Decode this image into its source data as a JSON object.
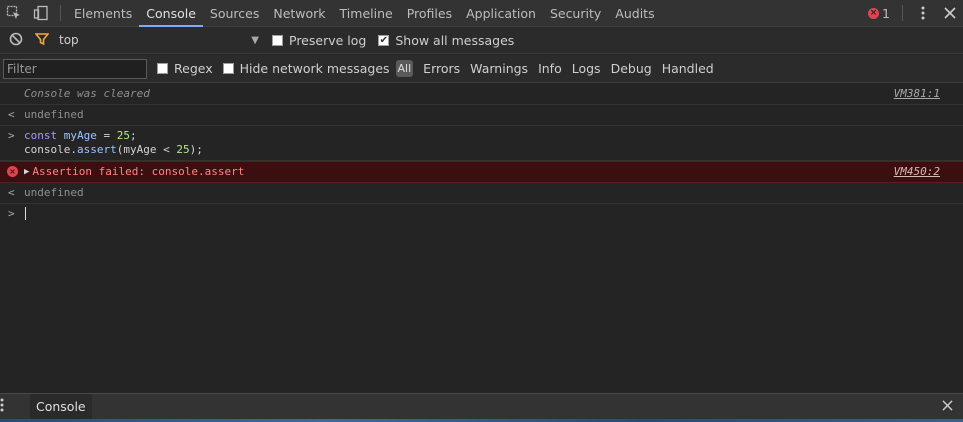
{
  "tabs": [
    "Elements",
    "Console",
    "Sources",
    "Network",
    "Timeline",
    "Profiles",
    "Application",
    "Security",
    "Audits"
  ],
  "active_tab": "Console",
  "error_count": "1",
  "toolbar": {
    "context": "top",
    "preserve_log_label": "Preserve log",
    "preserve_log_checked": false,
    "show_all_label": "Show all messages",
    "show_all_checked": true
  },
  "filter": {
    "placeholder": "Filter",
    "regex_label": "Regex",
    "hide_network_label": "Hide network messages",
    "levels": [
      "All",
      "Errors",
      "Warnings",
      "Info",
      "Logs",
      "Debug",
      "Handled"
    ]
  },
  "messages": {
    "cleared": {
      "text": "Console was cleared",
      "source": "VM381:1"
    },
    "result1": {
      "gutter": "<",
      "text": "undefined"
    },
    "input": {
      "gutter": ">",
      "line1": {
        "kw": "const",
        "var": "myAge",
        "op": " = ",
        "num": "25",
        "end": ";"
      },
      "line2": {
        "obj": "console.",
        "fn": "assert",
        "open": "(myAge < ",
        "num": "25",
        "close": ");"
      }
    },
    "error": {
      "text": "Assertion failed: console.assert",
      "source": "VM450:2"
    },
    "result2": {
      "gutter": "<",
      "text": "undefined"
    },
    "prompt": ">"
  },
  "drawer": {
    "tab": "Console"
  },
  "colors": {
    "accent": "#7cacf8",
    "error": "#e0454f",
    "error_bg": "#3b0e0f"
  }
}
